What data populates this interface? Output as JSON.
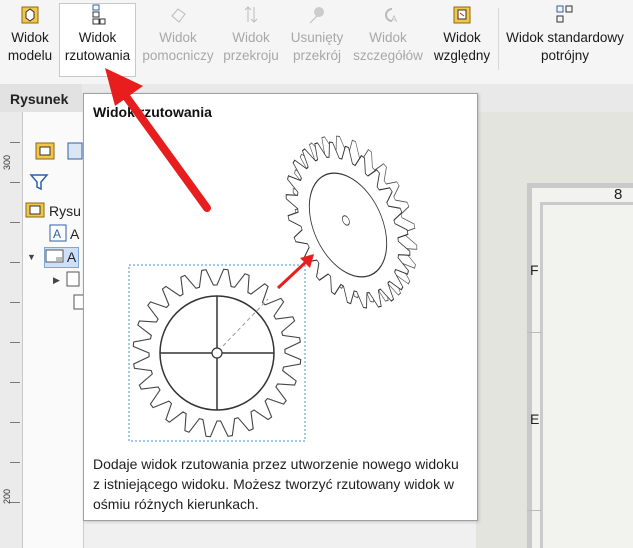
{
  "ribbon": {
    "buttons": [
      {
        "line1": "Widok",
        "line2": "modelu",
        "icon": "model-view-icon",
        "enabled": true
      },
      {
        "line1": "Widok",
        "line2": "rzutowania",
        "icon": "projected-view-icon",
        "enabled": true
      },
      {
        "line1": "Widok",
        "line2": "pomocniczy",
        "icon": "auxiliary-view-icon",
        "enabled": false
      },
      {
        "line1": "Widok",
        "line2": "przekroju",
        "icon": "section-view-icon",
        "enabled": false
      },
      {
        "line1": "Usunięty",
        "line2": "przekrój",
        "icon": "removed-section-icon",
        "enabled": false
      },
      {
        "line1": "Widok",
        "line2": "szczegółów",
        "icon": "detail-view-icon",
        "enabled": false
      },
      {
        "line1": "Widok",
        "line2": "względny",
        "icon": "relative-view-icon",
        "enabled": true
      },
      {
        "line1": "Widok standardowy",
        "line2": "potrójny",
        "icon": "standard-3-view-icon",
        "enabled": true
      }
    ]
  },
  "tabs": {
    "active": "Rysunek"
  },
  "ruler": {
    "marks": [
      "300",
      "200"
    ]
  },
  "tree": {
    "root_label": "Rysu",
    "item1": "A",
    "item2": "A"
  },
  "sheet": {
    "zone_top": "8",
    "zone_f": "F",
    "zone_e": "E"
  },
  "tooltip": {
    "title": "Widok rzutowania",
    "description": "Dodaje widok rzutowania przez utworzenie nowego widoku z istniejącego widoku. Możesz tworzyć rzutowany widok w ośmiu różnych kierunkach."
  },
  "colors": {
    "arrow": "#e81e1e",
    "icon_gold": "#e0a21a",
    "icon_blue": "#2d5fa8"
  }
}
